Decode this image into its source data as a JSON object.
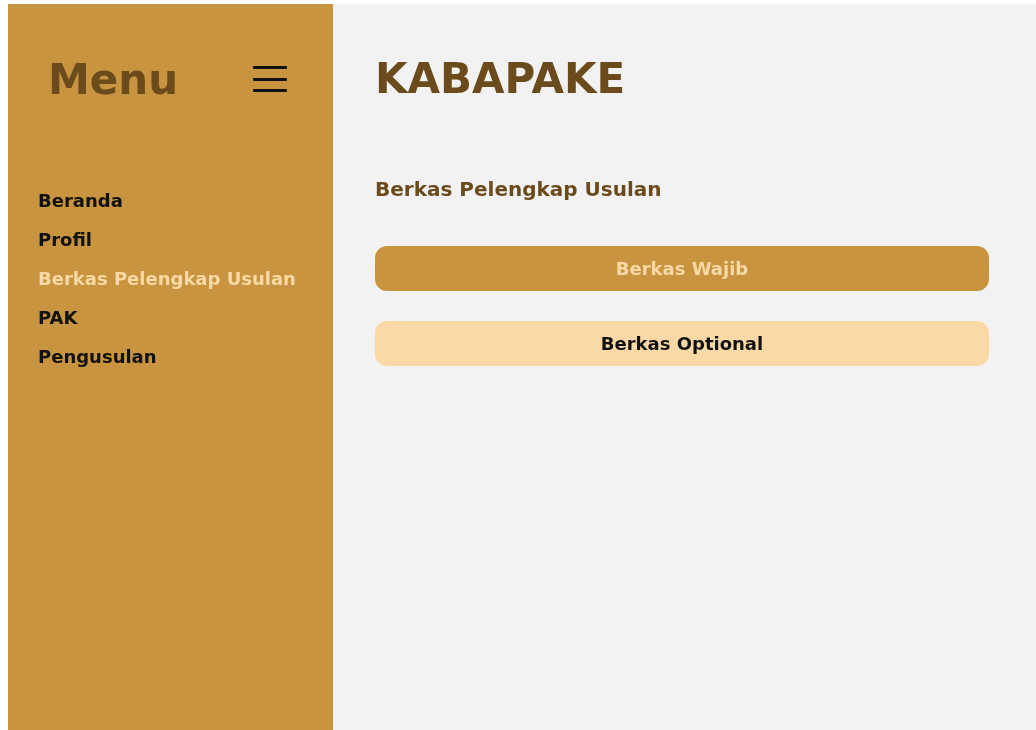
{
  "sidebar": {
    "title": "Menu",
    "items": [
      {
        "label": "Beranda",
        "selected": false
      },
      {
        "label": "Profil",
        "selected": false
      },
      {
        "label": "Berkas Pelengkap Usulan",
        "selected": true
      },
      {
        "label": "PAK",
        "selected": false
      },
      {
        "label": "Pengusulan",
        "selected": false
      }
    ]
  },
  "main": {
    "title": "KABAPAKE",
    "section_title": "Berkas Pelengkap Usulan",
    "buttons": [
      {
        "label": "Berkas Wajib",
        "selected": true
      },
      {
        "label": "Berkas Optional",
        "selected": false
      }
    ]
  }
}
